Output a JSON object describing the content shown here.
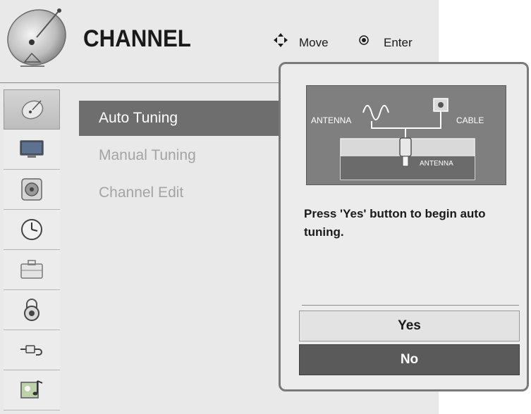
{
  "header": {
    "title": "CHANNEL",
    "move_label": "Move",
    "enter_label": "Enter"
  },
  "sidebar": {
    "items": [
      {
        "icon": "satellite-dish-icon",
        "active": true
      },
      {
        "icon": "monitor-icon",
        "active": false
      },
      {
        "icon": "speaker-icon",
        "active": false
      },
      {
        "icon": "clock-icon",
        "active": false
      },
      {
        "icon": "toolbox-icon",
        "active": false
      },
      {
        "icon": "padlock-icon",
        "active": false
      },
      {
        "icon": "input-plug-icon",
        "active": false
      },
      {
        "icon": "media-icon",
        "active": false
      }
    ]
  },
  "menu": {
    "items": [
      {
        "label": "Auto Tuning",
        "active": true
      },
      {
        "label": "Manual Tuning",
        "active": false
      },
      {
        "label": "Channel Edit",
        "active": false
      }
    ]
  },
  "popup": {
    "diagram": {
      "antenna_label": "ANTENNA",
      "cable_label": "CABLE",
      "port_label": "ANTENNA"
    },
    "message": "Press 'Yes' button to begin auto tuning.",
    "yes_label": "Yes",
    "no_label": "No"
  },
  "colors": {
    "panel_bg": "#e9e9e9",
    "selected_item": "#6e6e6e",
    "inactive_text": "#a4a4a4",
    "no_button": "#5a5a5a"
  }
}
